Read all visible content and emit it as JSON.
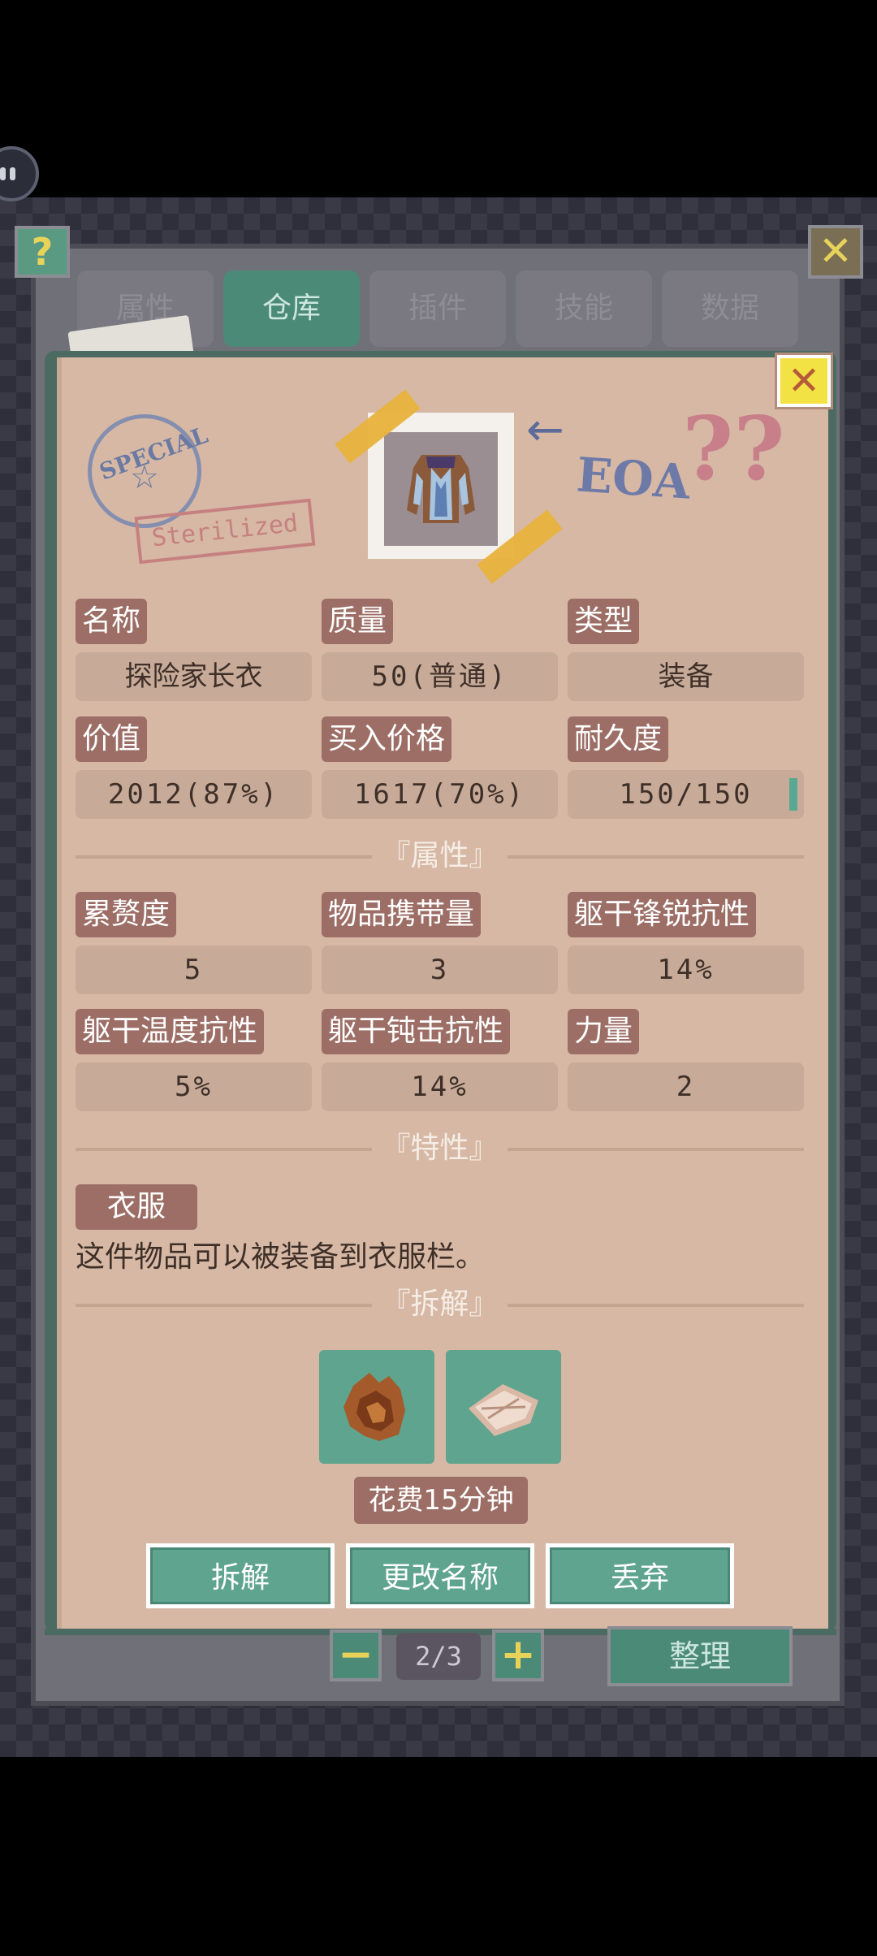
{
  "header": {
    "help_icon": "?",
    "close_icon": "✕",
    "tabs": [
      {
        "label": "属性",
        "active": false
      },
      {
        "label": "仓库",
        "active": true
      },
      {
        "label": "插件",
        "active": false
      },
      {
        "label": "技能",
        "active": false
      },
      {
        "label": "数据",
        "active": false
      }
    ]
  },
  "card": {
    "close_icon": "✕",
    "decor": {
      "stamp_circle_text": "SPECIAL",
      "stamp_rect_text": "Sterilized",
      "brand_text": "EOA",
      "question_marks": "??"
    },
    "basic": [
      {
        "label": "名称",
        "value": "探险家长衣"
      },
      {
        "label": "质量",
        "value": "50(普通)"
      },
      {
        "label": "类型",
        "value": "装备"
      },
      {
        "label": "价值",
        "value": "2012(87%)"
      },
      {
        "label": "买入价格",
        "value": "1617(70%)"
      },
      {
        "label": "耐久度",
        "value": "150/150"
      }
    ],
    "durability_fraction": 1.0,
    "attributes_title": "『属性』",
    "attributes": [
      {
        "label": "累赘度",
        "value": "5"
      },
      {
        "label": "物品携带量",
        "value": "3"
      },
      {
        "label": "躯干锋锐抗性",
        "value": "14%"
      },
      {
        "label": "躯干温度抗性",
        "value": "5%"
      },
      {
        "label": "躯干钝击抗性",
        "value": "14%"
      },
      {
        "label": "力量",
        "value": "2"
      }
    ],
    "traits_title": "『特性』",
    "trait": {
      "tag": "衣服",
      "description": "这件物品可以被装备到衣服栏。"
    },
    "dismantle_title": "『拆解』",
    "dismantle_parts": [
      "leather-scrap-icon",
      "cloth-scrap-icon"
    ],
    "dismantle_time": "花费15分钟",
    "actions": [
      {
        "label": "拆解"
      },
      {
        "label": "更改名称"
      },
      {
        "label": "丢弃"
      }
    ]
  },
  "footer": {
    "minus_icon": "−",
    "plus_icon": "+",
    "page": "2/3",
    "sort_label": "整理"
  },
  "colors": {
    "accent_green": "#5fa48e",
    "label_brown": "#9c6e66",
    "paper": "#d6b8a4"
  }
}
